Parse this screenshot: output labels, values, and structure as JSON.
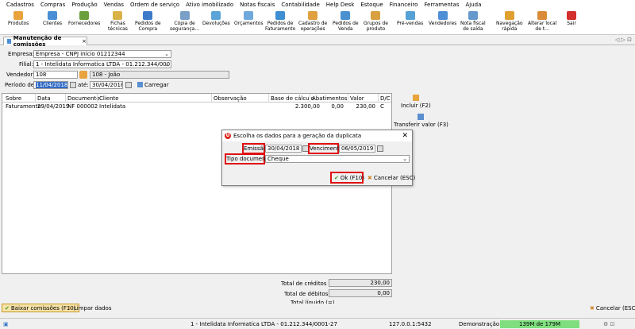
{
  "menu": [
    "Cadastros",
    "Compras",
    "Produção",
    "Vendas",
    "Ordem de serviço",
    "Ativo imobilizado",
    "Notas fiscais",
    "Contabilidade",
    "Help Desk",
    "Estoque",
    "Financeiro",
    "Ferramentas",
    "Ajuda"
  ],
  "toolbar": [
    {
      "label": "Produtos",
      "icon": "box-icon",
      "color": "#e8a33c"
    },
    {
      "label": "Clientes",
      "icon": "person-icon",
      "color": "#4a8fd6"
    },
    {
      "label": "Fornecedores",
      "icon": "people-icon",
      "color": "#6a9f3c"
    },
    {
      "label": "Fichas\ntécnicas",
      "icon": "sheet-icon",
      "color": "#d9b24a"
    },
    {
      "label": "Pedidos de\nCompra",
      "icon": "cart-icon",
      "color": "#3d7bc9"
    },
    {
      "label": "Cópia de\nsegurança...",
      "icon": "backup-icon",
      "color": "#7aa0c8"
    },
    {
      "label": "Devoluções",
      "icon": "return-icon",
      "color": "#5aa4d8"
    },
    {
      "label": "Orçamentos",
      "icon": "quote-icon",
      "color": "#6fa8dc"
    },
    {
      "label": "Pedidos de\nFaturamento",
      "icon": "invoice-icon",
      "color": "#3e8fd2"
    },
    {
      "label": "Cadastro de\noperações",
      "icon": "operations-icon",
      "color": "#e0a040"
    },
    {
      "label": "Pedidos de\nVenda",
      "icon": "sales-order-icon",
      "color": "#4b90d0"
    },
    {
      "label": "Grupos de\nproduto",
      "icon": "group-icon",
      "color": "#d8a040"
    },
    {
      "label": "Pré-vendas",
      "icon": "presale-icon",
      "color": "#55a1d6"
    },
    {
      "label": "Vendedores",
      "icon": "seller-icon",
      "color": "#4f8fd6"
    },
    {
      "label": "Nota fiscal\nde saída",
      "icon": "nfe-icon",
      "color": "#6699cc"
    },
    {
      "label": "Navegação\nrápida",
      "icon": "navigation-icon",
      "color": "#e0a030"
    },
    {
      "label": "Alterar local\nde t...",
      "icon": "home-icon",
      "color": "#d98b3a"
    },
    {
      "label": "Sair",
      "icon": "exit-icon",
      "color": "#d32f2f"
    }
  ],
  "tab": {
    "title": "Manutenção de comissões",
    "close": "×"
  },
  "tab_arrows": "◁ ▷ ⊡",
  "form": {
    "empresa_label": "Empresa:",
    "empresa_value": "Empresa - CNPJ início 01212344",
    "filial_label": "Filial:",
    "filial_value": "1 - Intelidata Informatica LTDA - 01.212.344/0001-27",
    "vendedor_label": "Vendedor:",
    "vendedor_code": "108",
    "vendedor_name": "108 - João",
    "periodo_label": "Período de:",
    "periodo_de": "11/04/2018",
    "ate_label": "até:",
    "periodo_ate": "30/04/2018",
    "carregar": "Carregar"
  },
  "grid": {
    "headers": [
      "Sobre",
      "Data",
      "Documento",
      "Cliente",
      "Observação",
      "Base de cálculo",
      "Abatimentos",
      "Valor",
      "D/C"
    ],
    "rows": [
      [
        "Faturamento",
        "29/04/2019",
        "NF 000002",
        "Intelidata",
        "",
        "2.300,00",
        "0,00",
        "230,00",
        "C"
      ]
    ]
  },
  "side": {
    "incluir": "Incluir (F2)",
    "transferir": "Transferir valor (F3)"
  },
  "totals": {
    "creditos_label": "Total de créditos (+)",
    "creditos_value": "230,00",
    "debitos_label": "Total de débitos (-)",
    "debitos_value": "0,00",
    "liquido_label": "Total líquido (=)"
  },
  "bottom": {
    "baixar": "Baixar comissões (F10)",
    "limpar": "Limpar dados",
    "cancelar": "Cancelar (ESC)"
  },
  "dialog": {
    "title": "Escolha os dados para a geração da duplicata",
    "emissao_label": "Emissão:",
    "emissao_value": "30/04/2018",
    "vencimento_label": "Vencimento:",
    "vencimento_value": "06/05/2019",
    "tipo_label": "Tipo documento:",
    "tipo_value": "Cheque",
    "ok": "Ok (F10)",
    "cancel": "Cancelar (ESC)"
  },
  "status": {
    "filial": "1 - Intelidata Informatica LTDA - 01.212.344/0001-27",
    "server": "127.0.0.1:5432",
    "user": "Demonstração",
    "memory": "139M de 179M"
  },
  "colors": {
    "highlight": "#e01010",
    "selection": "#316ac5",
    "memory_bar": "#7fdf7f"
  }
}
